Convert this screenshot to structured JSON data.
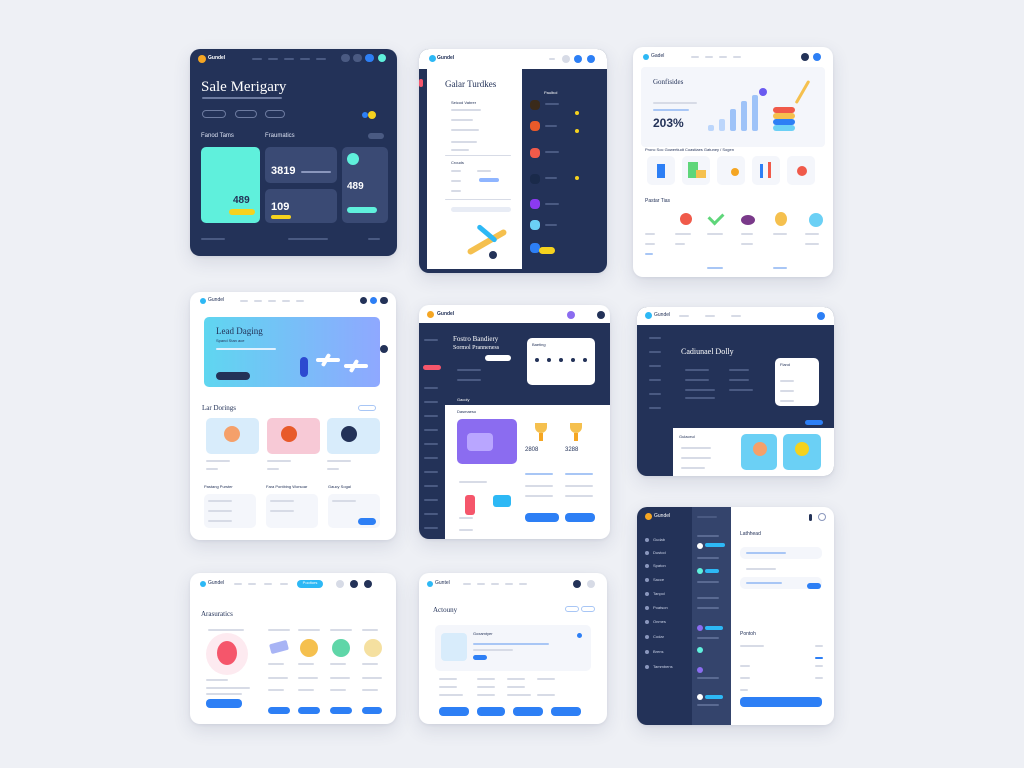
{
  "colors": {
    "navy": "#233258",
    "accent_blue": "#2d7ff5",
    "teal": "#5ff0dc",
    "yellow": "#f5d21e",
    "purple": "#8b6cf0",
    "pink": "#f7c9d6",
    "light_blue": "#d8ecfb"
  },
  "card1": {
    "logo": "Gundel",
    "title": "Sale Merigary",
    "section_a": "Fanod Tams",
    "section_b": "Fraumatics",
    "big_value": "489",
    "value_a": "3819",
    "value_b": "109",
    "value_c": "489"
  },
  "card2": {
    "logo": "Gundel",
    "title": "Galar Turdkes",
    "section_a": "Seicod Vabrer",
    "section_b": "Crouds",
    "side_label": "Paulbol"
  },
  "card3": {
    "logo": "Gadel",
    "title": "Gonfisides",
    "stat": "203%",
    "row_label": "Pronc Soc Gowertiudt Coastiaes Gatuney / Sogen",
    "section": "Pastar Tias"
  },
  "card4": {
    "logo": "Gundel",
    "hero_title": "Lead Daging",
    "hero_sub": "Spand Stan ace",
    "section": "Lar Dorings",
    "col_a": "Pastang Purster",
    "col_b": "Fara Pontbing Worsoar",
    "col_c": "Gaucy Sogal"
  },
  "card5": {
    "logo": "Gundel",
    "title": "Fostro Bandiery",
    "subtitle": "Sormol Pranneness",
    "panel_title": "Baeting",
    "section": "Gacoly",
    "subsection": "Dasmaeso",
    "value_a": "2808",
    "value_b": "3288"
  },
  "card6": {
    "logo": "Gundel",
    "title": "Cadiunael Dolly",
    "panel_title": "Fland",
    "section": "Gulaceul"
  },
  "card7": {
    "logo": "Gundel",
    "title": "Arasuratics",
    "tab_active": "Pooltors"
  },
  "card8": {
    "logo": "Guntel",
    "title": "Actouny",
    "panel_title": "Goxamtyer"
  },
  "card9": {
    "logo": "Gundel",
    "title": "Lathhead",
    "section": "Pontoh",
    "sidebar_items": [
      "Gudab",
      "Dustod",
      "Spaton",
      "Sacce",
      "Tanpol",
      "Poatson",
      "Onmes",
      "Codar",
      "Brens",
      "Tammbens"
    ]
  }
}
